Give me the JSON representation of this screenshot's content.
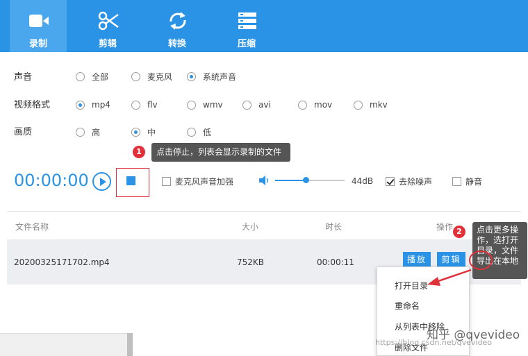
{
  "tabs": [
    {
      "label": "录制",
      "icon": "video-camera-icon",
      "active": true
    },
    {
      "label": "剪辑",
      "icon": "scissors-icon",
      "active": false
    },
    {
      "label": "转换",
      "icon": "refresh-icon",
      "active": false
    },
    {
      "label": "压缩",
      "icon": "compress-icon",
      "active": false
    }
  ],
  "audio": {
    "label": "声音",
    "options": [
      "全部",
      "麦克风",
      "系统声音"
    ],
    "selected": "系统声音"
  },
  "format": {
    "label": "视频格式",
    "options": [
      "mp4",
      "flv",
      "wmv",
      "avi",
      "mov",
      "mkv"
    ],
    "selected": "mp4"
  },
  "quality": {
    "label": "画质",
    "options": [
      "高",
      "中",
      "低"
    ],
    "selected": "中"
  },
  "callout1": {
    "num": "1",
    "text": "点击停止，列表会显示录制的文件"
  },
  "recorder": {
    "timer": "00:00:00",
    "mic_boost": "麦克风声音加强",
    "volume": "44dB",
    "volume_level": 0.44,
    "denoise": "去除噪声",
    "mute": "静音"
  },
  "table": {
    "headers": {
      "name": "文件名称",
      "size": "大小",
      "duration": "时长",
      "action": "操作"
    },
    "row": {
      "name": "20200325171702.mp4",
      "size": "752KB",
      "duration": "00:00:11",
      "play": "播放",
      "edit": "剪辑"
    }
  },
  "context_menu": [
    "打开目录",
    "重命名",
    "从列表中移除",
    "删除文件"
  ],
  "callout2": {
    "num": "2",
    "text": "点击更多操作，选打开目录，文件导出在本地"
  },
  "watermark": {
    "main": "知乎 @qvevideo",
    "url": "https://blog.csdn.net/qvevideo"
  },
  "colors": {
    "accent": "#2a93e6",
    "badge": "#e0313a",
    "tip_bg": "#555555"
  }
}
